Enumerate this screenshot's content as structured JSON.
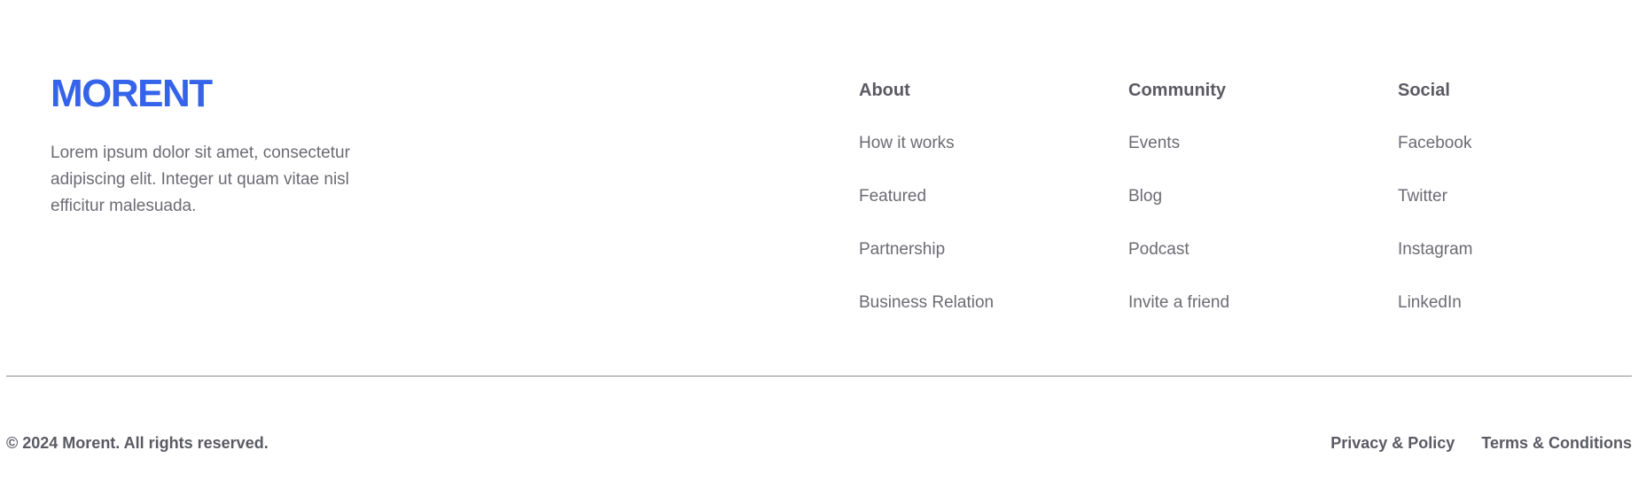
{
  "brand": {
    "logo_text": "MORENT",
    "tagline": "Lorem ipsum dolor sit amet, consectetur adipiscing elit. Integer ut quam vitae nisl efficitur malesuada.",
    "logo_color": "#3563e9"
  },
  "columns": {
    "about": {
      "title": "About",
      "links": [
        "How it works",
        "Featured",
        "Partnership",
        "Business Relation"
      ]
    },
    "community": {
      "title": "Community",
      "links": [
        "Events",
        "Blog",
        "Podcast",
        "Invite a friend"
      ]
    },
    "social": {
      "title": "Social",
      "links": [
        "Facebook",
        "Twitter",
        "Instagram",
        "LinkedIn"
      ]
    }
  },
  "bottom": {
    "copyright": "© 2024 Morent. All rights reserved.",
    "privacy_label": "Privacy & Policy",
    "terms_label": "Terms & Conditions"
  },
  "colors": {
    "text": "#6b6b73",
    "heading": "#5a5a63",
    "accent": "#3563e9",
    "divider": "#8a8a92"
  }
}
